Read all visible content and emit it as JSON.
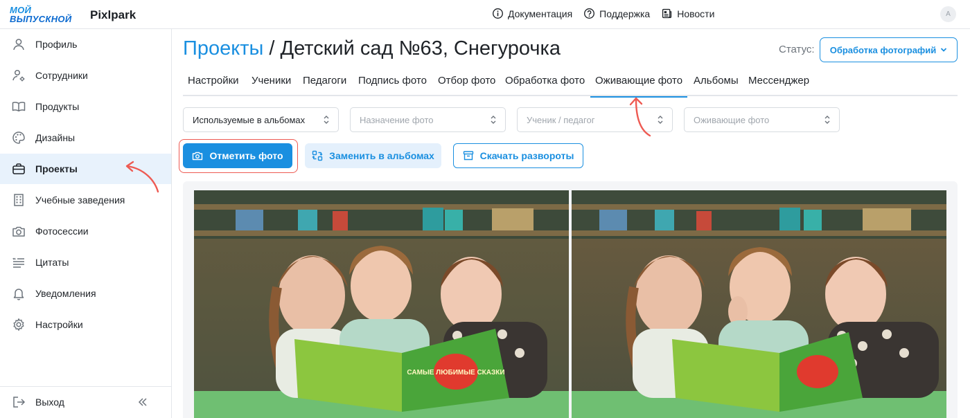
{
  "app": {
    "logo_line1": "МОЙ",
    "logo_line2": "ВЫПУСКНОЙ",
    "brand": "Pixlpark",
    "avatar_initial": "A"
  },
  "top_links": [
    {
      "label": "Документация",
      "icon": "info-icon"
    },
    {
      "label": "Поддержка",
      "icon": "help-icon"
    },
    {
      "label": "Новости",
      "icon": "news-icon"
    }
  ],
  "sidebar": {
    "items": [
      {
        "label": "Профиль",
        "icon": "user-icon"
      },
      {
        "label": "Сотрудники",
        "icon": "user-gear-icon"
      },
      {
        "label": "Продукты",
        "icon": "book-icon"
      },
      {
        "label": "Дизайны",
        "icon": "palette-icon"
      },
      {
        "label": "Проекты",
        "icon": "briefcase-icon",
        "active": true
      },
      {
        "label": "Учебные заведения",
        "icon": "building-icon"
      },
      {
        "label": "Фотосессии",
        "icon": "camera-icon"
      },
      {
        "label": "Цитаты",
        "icon": "quote-icon"
      },
      {
        "label": "Уведомления",
        "icon": "bell-icon"
      },
      {
        "label": "Настройки",
        "icon": "gear-icon"
      }
    ],
    "logout_label": "Выход"
  },
  "header": {
    "breadcrumb": "Проекты",
    "separator": "/",
    "title": "Детский сад №63, Снегурочка",
    "status_label": "Статус:",
    "status_value": "Обработка фотографий"
  },
  "tabs": [
    {
      "label": "Настройки"
    },
    {
      "label": "Ученики"
    },
    {
      "label": "Педагоги"
    },
    {
      "label": "Подпись фото"
    },
    {
      "label": "Отбор фото"
    },
    {
      "label": "Обработка фото"
    },
    {
      "label": "Оживающие фото",
      "active": true
    },
    {
      "label": "Альбомы"
    },
    {
      "label": "Мессенджер"
    }
  ],
  "filters": [
    {
      "value": "Используемые в альбомах",
      "placeholder": ""
    },
    {
      "value": "",
      "placeholder": "Назначение фото"
    },
    {
      "value": "",
      "placeholder": "Ученик / педагог"
    },
    {
      "value": "",
      "placeholder": "Оживающие фото"
    }
  ],
  "actions": {
    "mark_photo": "Отметить фото",
    "replace_in_albums": "Заменить в альбомах",
    "download_spreads": "Скачать развороты"
  },
  "book_title": "САМЫЕ ЛЮБИМЫЕ СКАЗКИ",
  "colors": {
    "accent": "#1a8fe0",
    "annotation": "#ee5a52",
    "active_bg": "#e8f2fc"
  }
}
